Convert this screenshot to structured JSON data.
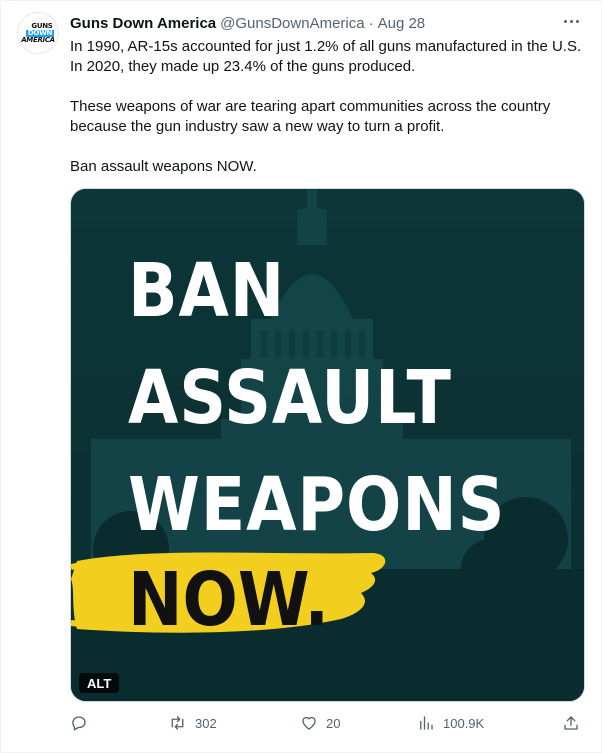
{
  "author": {
    "name": "Guns Down America",
    "handle": "@GunsDownAmerica",
    "separator": "·",
    "date": "Aug 28",
    "avatar_text": [
      "GUNS",
      "DOWN",
      "AMERICA"
    ]
  },
  "tweet": {
    "paragraphs": [
      "In 1990, AR-15s accounted for just 1.2% of all guns manufactured in the U.S. In 2020, they made up 23.4% of the guns produced.",
      "These weapons of war are tearing apart communities across the country because the gun industry saw a new way to turn a profit.",
      "Ban assault weapons NOW."
    ]
  },
  "media": {
    "lines": [
      "BAN",
      "ASSAULT",
      "WEAPONS"
    ],
    "highlight": "NOW.",
    "alt_badge": "ALT",
    "colors": {
      "background": "#0b3336",
      "text": "#ffffff",
      "highlight_stroke": "#f2cf1f"
    }
  },
  "actions": {
    "reply": {
      "icon": "reply-icon",
      "count": ""
    },
    "retweet": {
      "icon": "retweet-icon",
      "count": "302"
    },
    "like": {
      "icon": "heart-icon",
      "count": "20"
    },
    "views": {
      "icon": "views-chart-icon",
      "count": "100.9K"
    },
    "share": {
      "icon": "share-icon",
      "count": ""
    }
  },
  "colors": {
    "secondary_text": "#536471",
    "primary_text": "#0f1419"
  }
}
